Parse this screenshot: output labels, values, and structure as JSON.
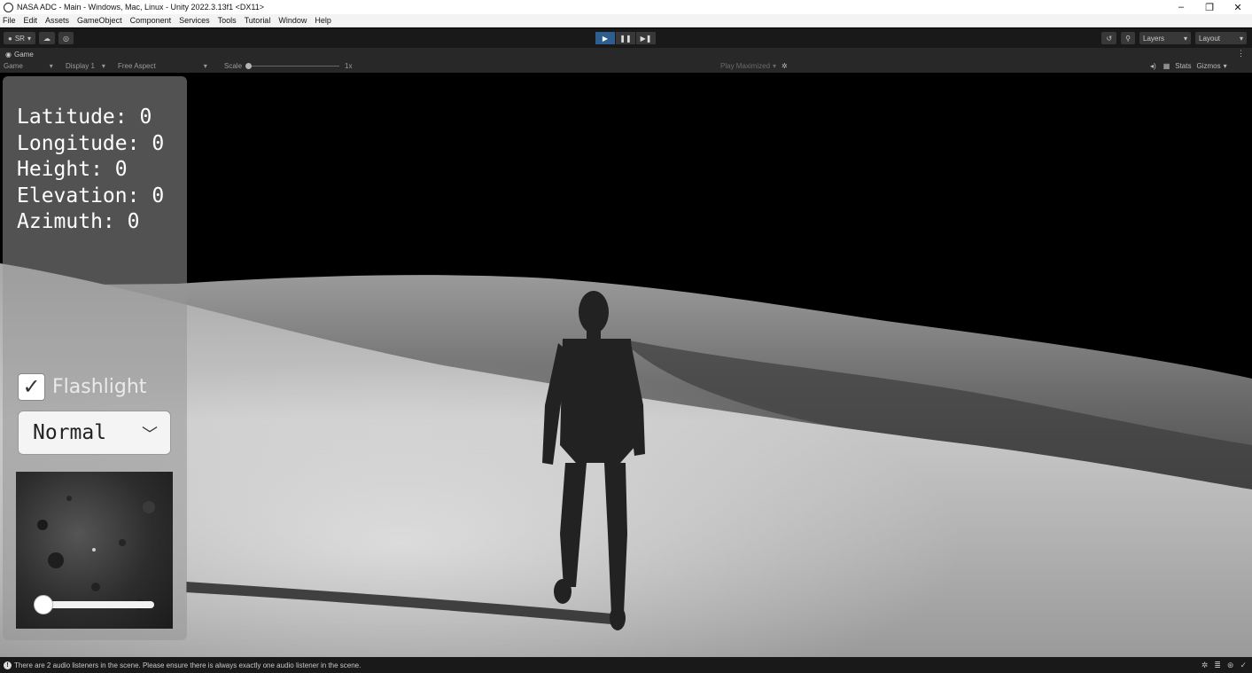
{
  "window": {
    "title": "NASA ADC - Main - Windows, Mac, Linux - Unity 2022.3.13f1 <DX11>",
    "minimize": "–",
    "restore": "❐",
    "close": "✕"
  },
  "menu": [
    "File",
    "Edit",
    "Assets",
    "GameObject",
    "Component",
    "Services",
    "Tools",
    "Tutorial",
    "Window",
    "Help"
  ],
  "toolbar": {
    "account_label": "SR",
    "layers_label": "Layers",
    "layout_label": "Layout"
  },
  "game_tab": {
    "label": "Game"
  },
  "game_bar": {
    "view_select": "Game",
    "display_select": "Display 1",
    "aspect_select": "Free Aspect",
    "scale_label": "Scale",
    "scale_value": "1x",
    "play_maximized": "Play Maximized",
    "stats": "Stats",
    "gizmos": "Gizmos"
  },
  "hud": {
    "coords": [
      "Latitude: 0",
      "Longitude: 0",
      "Height: 0",
      "Elevation: 0",
      "Azimuth: 0"
    ],
    "flashlight_label": "Flashlight",
    "flashlight_checked": true,
    "mode_select": "Normal",
    "slider_value": 0
  },
  "status": {
    "message": "There are 2 audio listeners in the scene. Please ensure there is always exactly one audio listener in the scene."
  },
  "colors": {
    "unity_dark": "#191919",
    "panel": "#282828",
    "play_active": "#2e5d8f"
  }
}
